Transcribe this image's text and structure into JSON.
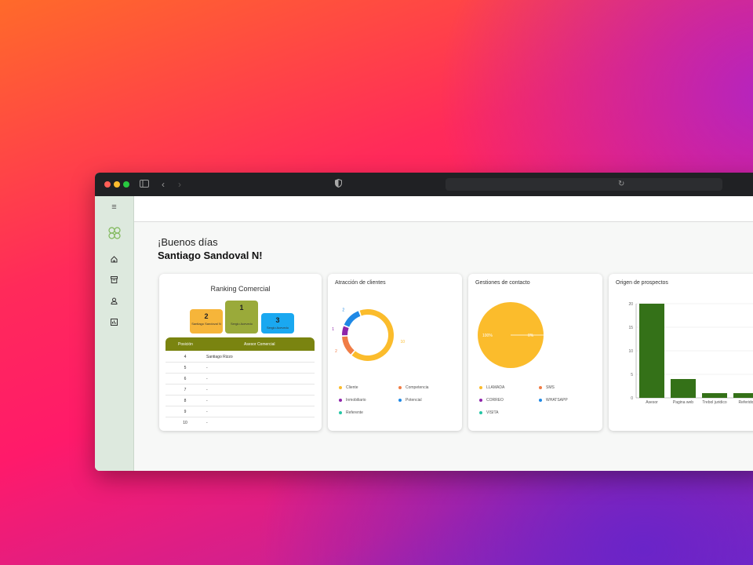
{
  "window": {
    "traffic_colors": [
      "#ff5f57",
      "#febc2e",
      "#28c840"
    ],
    "urlbar": {
      "value": ""
    }
  },
  "sidebar": {
    "menu_icon": "hamburger-menu-icon",
    "logo_icon": "clover-logo-icon",
    "items": [
      {
        "icon": "home-icon"
      },
      {
        "icon": "archive-icon"
      },
      {
        "icon": "user-icon"
      },
      {
        "icon": "report-icon"
      }
    ]
  },
  "greeting": {
    "line1": "¡Buenos días",
    "line2": "Santiago Sandoval N!"
  },
  "ranking": {
    "title": "Ranking Comercial",
    "podium": [
      {
        "pos": "2",
        "name": "Santiago Sandoval N",
        "color": "#f6b53a"
      },
      {
        "pos": "1",
        "name": "Sergio Acevedo",
        "color": "#9aaa3a"
      },
      {
        "pos": "3",
        "name": "Sergio Acevedo",
        "color": "#1aa8f0"
      }
    ],
    "headers": {
      "position": "Posición",
      "advisor": "Asesor Comercial"
    },
    "rows": [
      {
        "pos": "4",
        "advisor": "Santiago Rizzo"
      },
      {
        "pos": "5",
        "advisor": "-"
      },
      {
        "pos": "6",
        "advisor": "-"
      },
      {
        "pos": "7",
        "advisor": "-"
      },
      {
        "pos": "8",
        "advisor": "-"
      },
      {
        "pos": "9",
        "advisor": "-"
      },
      {
        "pos": "10",
        "advisor": "-"
      }
    ]
  },
  "atraccion": {
    "title": "Atracción de clientes",
    "chart_data": {
      "type": "pie",
      "style": "donut",
      "labels": [
        "Cliente",
        "Competencia",
        "Inmobiliario",
        "Potencial",
        "Referente"
      ],
      "values": [
        10,
        2,
        1,
        2,
        0
      ],
      "colors": [
        "#fbbc2c",
        "#f07c45",
        "#8e24aa",
        "#1e88e5",
        "#26c6a6"
      ],
      "data_labels": [
        "10",
        "2",
        "1",
        "2",
        "0"
      ]
    }
  },
  "gestiones": {
    "title": "Gestiones de contacto",
    "chart_data": {
      "type": "pie",
      "labels": [
        "LLAMADA",
        "SMS",
        "CORREO",
        "WHATSAPP",
        "VISITA"
      ],
      "values": [
        100,
        0,
        0,
        0,
        0
      ],
      "colors": [
        "#fbbc2c",
        "#f07c45",
        "#8e24aa",
        "#1e88e5",
        "#26c6a6"
      ],
      "data_labels": [
        "100%",
        "0%"
      ]
    }
  },
  "origen": {
    "title": "Origen de prospectos",
    "chart_data": {
      "type": "bar",
      "categories": [
        "Asesor",
        "Pagina web",
        "Trebol juridico",
        "Referido"
      ],
      "values": [
        20,
        4,
        1,
        1
      ],
      "ylim": [
        0,
        20
      ],
      "yticks": [
        0,
        5,
        10,
        15,
        20
      ],
      "bar_color": "#347118",
      "grid": true
    }
  }
}
